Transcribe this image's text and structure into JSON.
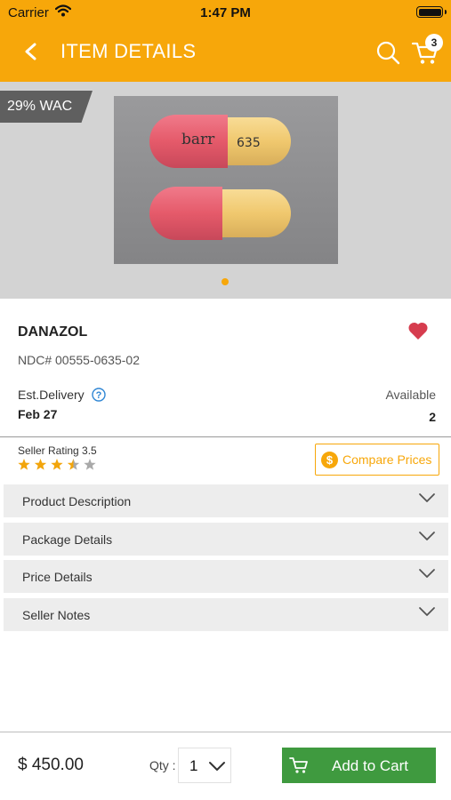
{
  "status_bar": {
    "carrier": "Carrier",
    "time": "1:47 PM"
  },
  "nav": {
    "title": "ITEM DETAILS",
    "cart_count": "3"
  },
  "colors": {
    "brand": "#f7a70a",
    "add_to_cart": "#3f9a3f",
    "favorite": "#d63c4e",
    "help": "#2f86d4"
  },
  "gallery": {
    "badge": "29% WAC",
    "pill_imprint_top": "barr",
    "pill_number": "635",
    "active_page": 1,
    "page_count": 1
  },
  "product": {
    "name": "DANAZOL",
    "ndc": "NDC# 00555-0635-02",
    "est_delivery_label": "Est.Delivery",
    "est_delivery_date": "Feb 27",
    "available_label": "Available",
    "available_count": "2",
    "favorited": true
  },
  "seller": {
    "rating_label": "Seller Rating 3.5",
    "rating": 3.5,
    "rating_max": 5
  },
  "compare_prices_label": "Compare Prices",
  "sections": [
    {
      "label": "Product Description"
    },
    {
      "label": "Package Details"
    },
    {
      "label": "Price Details"
    },
    {
      "label": "Seller Notes"
    }
  ],
  "footer": {
    "price": "$ 450.00",
    "qty_label": "Qty :",
    "qty_value": "1",
    "add_to_cart_label": "Add to Cart"
  }
}
